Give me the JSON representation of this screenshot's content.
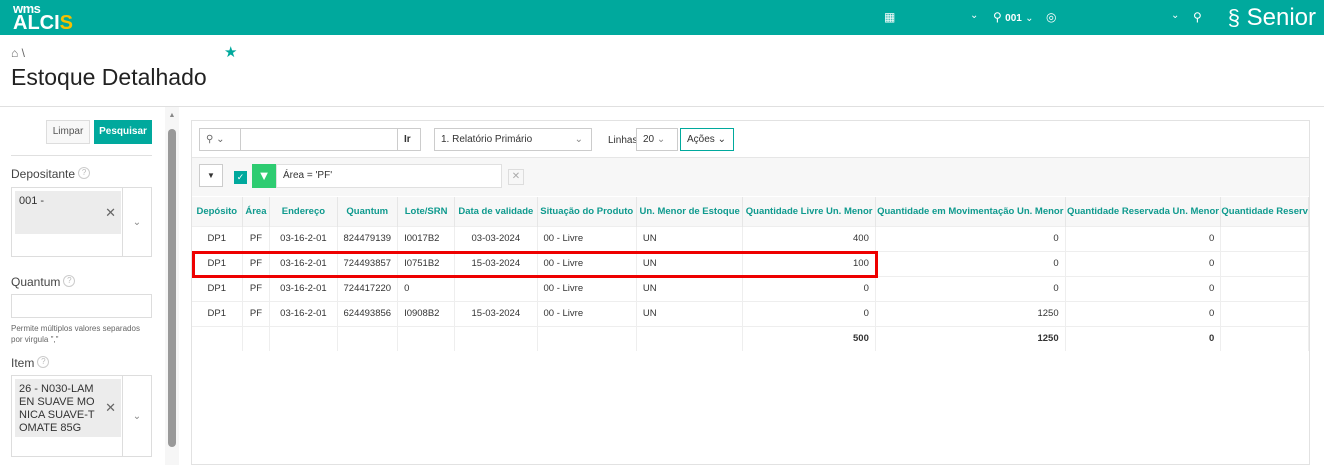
{
  "header": {
    "logo_top": "wms",
    "logo_main": "ALCI",
    "logo_accent": "S",
    "location": "001",
    "brand": "Senior",
    "brand_color": "#00a99d"
  },
  "breadcrumb": {
    "separator": "\\"
  },
  "page": {
    "title": "Estoque Detalhado"
  },
  "filters": {
    "clear_label": "Limpar",
    "search_label": "Pesquisar",
    "depositante": {
      "label": "Depositante",
      "value": "001 -"
    },
    "quantum": {
      "label": "Quantum",
      "value": "",
      "hint": "Permite múltiplos valores separados por virgula \",\""
    },
    "item": {
      "label": "Item",
      "value": "26 - N030-LAMEN SUAVE MONICA SUAVE-TOMATE 85G"
    }
  },
  "toolbar": {
    "search_value": "",
    "go_label": "Ir",
    "report": "1. Relatório Primário",
    "rows_label": "Linhas",
    "rows_value": "20",
    "actions_label": "Ações"
  },
  "filter_chip": {
    "text": "Área = 'PF'",
    "checked": true
  },
  "table": {
    "columns": [
      "Depósito",
      "Área",
      "Endereço",
      "Quantum",
      "Lote/SRN",
      "Data de validade",
      "Situação do Produto",
      "Un. Menor de Estoque",
      "Quantidade Livre Un. Menor",
      "Quantidade em Movimentação Un. Menor",
      "Quantidade Reservada Un. Menor",
      "Quantidade Reserv"
    ],
    "rows": [
      [
        "DP1",
        "PF",
        "03-16-2-01",
        "824479139",
        "I0017B2",
        "03-03-2024",
        "00 - Livre",
        "UN",
        "400",
        "0",
        "0",
        ""
      ],
      [
        "DP1",
        "PF",
        "03-16-2-01",
        "724493857",
        "I0751B2",
        "15-03-2024",
        "00 - Livre",
        "UN",
        "100",
        "0",
        "0",
        ""
      ],
      [
        "DP1",
        "PF",
        "03-16-2-01",
        "724417220",
        "0",
        "",
        "00 - Livre",
        "UN",
        "0",
        "0",
        "0",
        ""
      ],
      [
        "DP1",
        "PF",
        "03-16-2-01",
        "624493856",
        "I0908B2",
        "15-03-2024",
        "00 - Livre",
        "UN",
        "0",
        "1250",
        "0",
        ""
      ]
    ],
    "totals": [
      "",
      "",
      "",
      "",
      "",
      "",
      "",
      "",
      "500",
      "1250",
      "0",
      ""
    ],
    "highlighted_row": 1
  }
}
